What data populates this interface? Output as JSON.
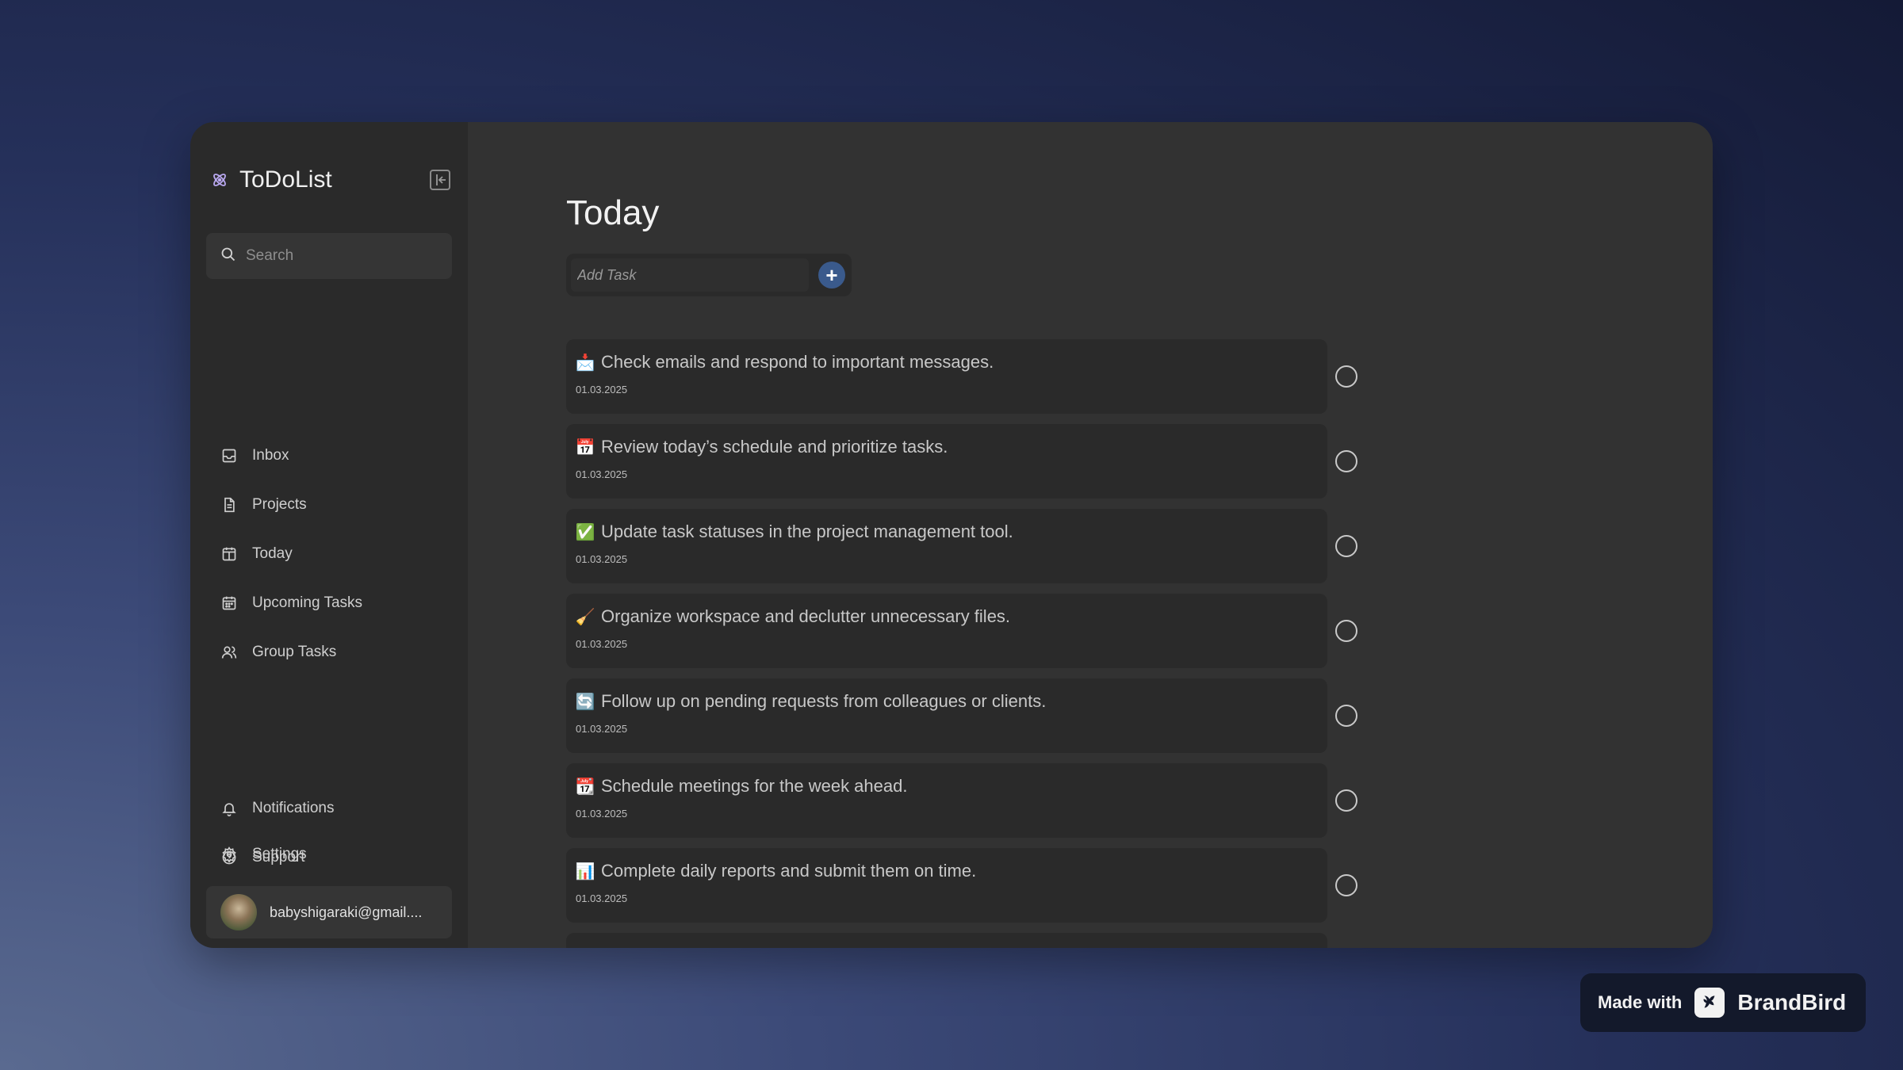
{
  "app": {
    "title": "ToDoList",
    "brand_icon": "atom-icon",
    "accent_color": "#3a5a8c"
  },
  "sidebar": {
    "search_placeholder": "Search",
    "nav": [
      {
        "label": "Inbox",
        "icon": "inbox-icon"
      },
      {
        "label": "Projects",
        "icon": "document-icon"
      },
      {
        "label": "Today",
        "icon": "calendar-today-icon"
      },
      {
        "label": "Upcoming Tasks",
        "icon": "calendar-icon"
      },
      {
        "label": "Group Tasks",
        "icon": "users-icon"
      }
    ],
    "bottom_nav": [
      {
        "label": "Notifications",
        "icon": "bell-icon"
      },
      {
        "label": "Support",
        "icon": "help-icon"
      },
      {
        "label": "Settings",
        "icon": "gear-icon"
      }
    ],
    "user_email": "babyshigaraki@gmail...."
  },
  "main": {
    "title": "Today",
    "add_task_placeholder": "Add Task",
    "tasks": [
      {
        "emoji": "📩",
        "text": "Check emails and respond to important messages.",
        "date": "01.03.2025"
      },
      {
        "emoji": "📅",
        "text": "Review today’s schedule and prioritize tasks.",
        "date": "01.03.2025"
      },
      {
        "emoji": "✅",
        "text": "Update task statuses in the project management tool.",
        "date": "01.03.2025"
      },
      {
        "emoji": "🧹",
        "text": "Organize workspace and declutter unnecessary files.",
        "date": "01.03.2025"
      },
      {
        "emoji": "🔄",
        "text": "Follow up on pending requests from colleagues or clients.",
        "date": "01.03.2025"
      },
      {
        "emoji": "📆",
        "text": "Schedule meetings for the week ahead.",
        "date": "01.03.2025"
      },
      {
        "emoji": "📊",
        "text": "Complete daily reports and submit them on time.",
        "date": "01.03.2025"
      }
    ]
  },
  "badge": {
    "prefix": "Made with",
    "brand": "BrandBird"
  }
}
